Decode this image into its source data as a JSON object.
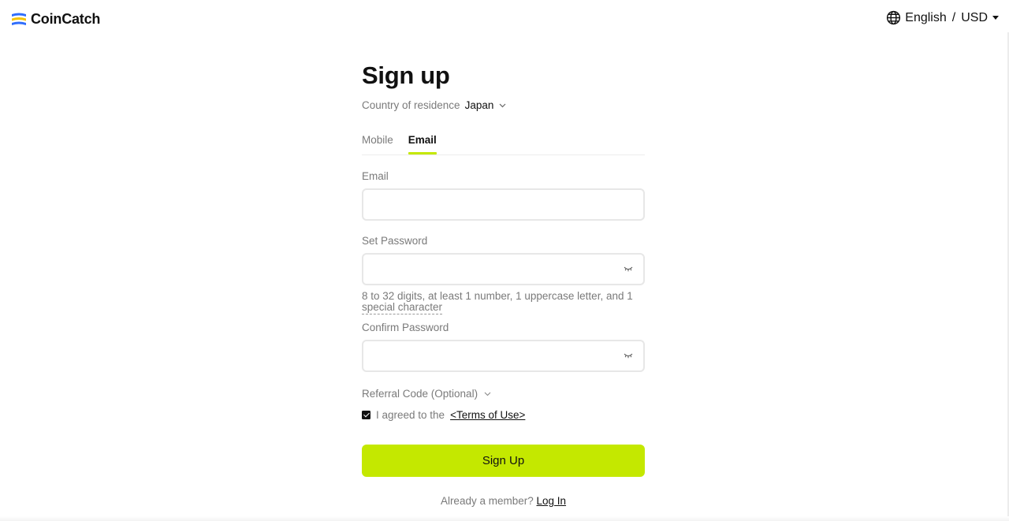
{
  "header": {
    "brand": "CoinCatch",
    "language": "English",
    "separator": "/",
    "currency": "USD",
    "colors": {
      "brand_blue": "#2f6dfc",
      "brand_yellow": "#f5c400"
    }
  },
  "form": {
    "title": "Sign up",
    "country_label": "Country of residence",
    "country_value": "Japan",
    "tabs": [
      {
        "label": "Mobile",
        "active": false
      },
      {
        "label": "Email",
        "active": true
      }
    ],
    "email_label": "Email",
    "email_value": "",
    "password_label": "Set Password",
    "password_value": "",
    "password_hint": "8 to 32 digits, at least 1 number, 1 uppercase letter, and 1",
    "password_hint_link": "special character",
    "confirm_label": "Confirm Password",
    "confirm_value": "",
    "referral_label": "Referral Code (Optional)",
    "agree_text": "I agreed to the",
    "terms_link": "<Terms of Use>",
    "agree_checked": true,
    "submit_label": "Sign Up",
    "member_text": "Already a member?",
    "login_link": "Log In",
    "accent_color": "#c4e800"
  },
  "icons": {
    "logo": "coincatch-logo-icon",
    "globe": "globe-icon",
    "language_caret": "caret-down-icon",
    "country_chevron": "chevron-down-icon",
    "eye": "eye-closed-icon",
    "referral_chevron": "chevron-down-icon",
    "checkbox": "checkbox-checked-icon"
  }
}
